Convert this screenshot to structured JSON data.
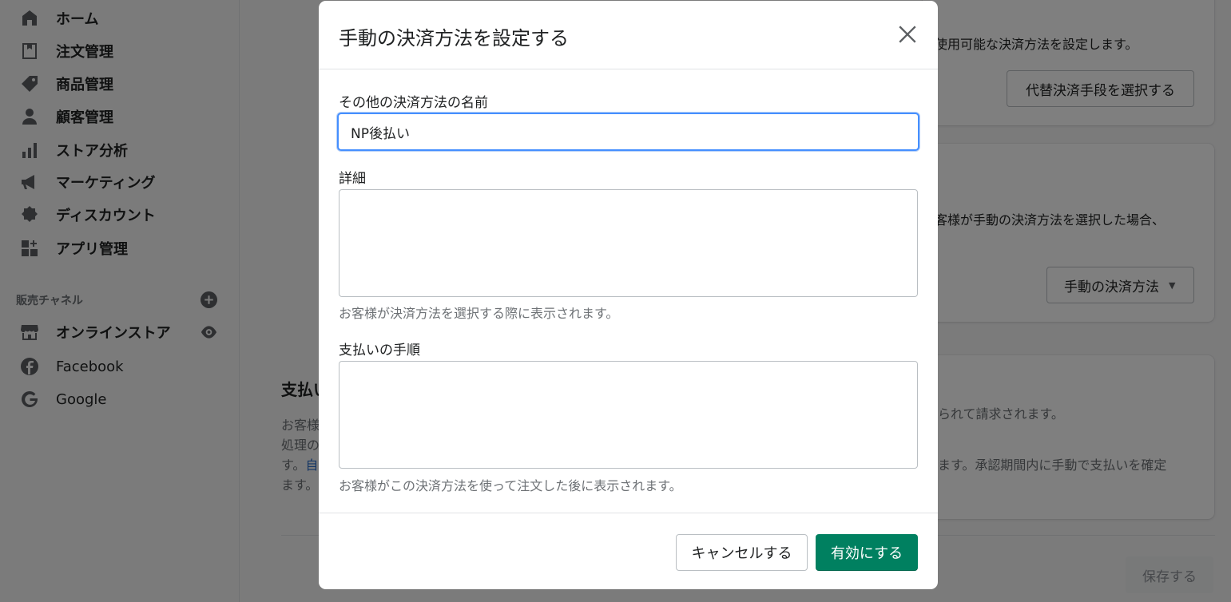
{
  "sidebar": {
    "items": [
      {
        "label": "ホーム",
        "icon": "home-icon"
      },
      {
        "label": "注文管理",
        "icon": "orders-icon"
      },
      {
        "label": "商品管理",
        "icon": "tag-icon"
      },
      {
        "label": "顧客管理",
        "icon": "person-icon"
      },
      {
        "label": "ストア分析",
        "icon": "analytics-icon"
      },
      {
        "label": "マーケティング",
        "icon": "megaphone-icon"
      },
      {
        "label": "ディスカウント",
        "icon": "discount-icon"
      },
      {
        "label": "アプリ管理",
        "icon": "apps-icon"
      }
    ],
    "sales_channels_label": "販売チャネル",
    "channels": [
      {
        "label": "オンラインストア",
        "icon": "store-icon"
      },
      {
        "label": "Facebook",
        "icon": "facebook-icon"
      },
      {
        "label": "Google",
        "icon": "google-icon"
      }
    ]
  },
  "background": {
    "card1_text": "使用可能な決済方法を設定します。",
    "card1_button": "代替決済手段を選択する",
    "card2_text": "客様が手動の決済方法を選択した場合、",
    "card2_button": "手動の決済方法",
    "section_heading": "支払い",
    "para_left_1": "お客様",
    "para_left_2": "処理の",
    "para_left_3a": "す。",
    "para_left_3b": "自",
    "para_left_4": "ます。",
    "para_right_1": "られて請求されます。",
    "para_right_2": "ます。承認期間内に手動で支払いを確定",
    "save_button": "保存する"
  },
  "modal": {
    "title": "手動の決済方法を設定する",
    "name_label": "その他の決済方法の名前",
    "name_value": "NP後払い",
    "details_label": "詳細",
    "details_help": "お客様が決済方法を選択する際に表示されます。",
    "instructions_label": "支払いの手順",
    "instructions_help": "お客様がこの決済方法を使って注文した後に表示されます。",
    "cancel_button": "キャンセルする",
    "enable_button": "有効にする"
  },
  "colors": {
    "primary": "#008060",
    "focus": "#458fff",
    "overlay": "rgba(0,0,0,0.5)"
  }
}
